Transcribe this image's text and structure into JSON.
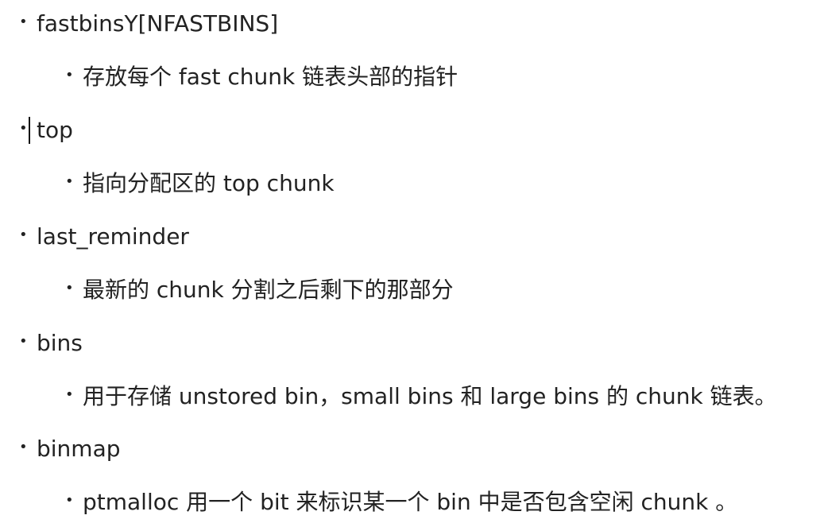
{
  "bullet_glyph": "•",
  "items": [
    {
      "term": "fastbinsY[NFASTBINS]",
      "description": "存放每个 fast chunk 链表头部的指针"
    },
    {
      "term": "top",
      "description": "指向分配区的 top chunk"
    },
    {
      "term": "last_reminder",
      "description": "最新的 chunk 分割之后剩下的那部分"
    },
    {
      "term": "bins",
      "description": "用于存储 unstored bin，small bins 和 large bins 的 chunk 链表。"
    },
    {
      "term": "binmap",
      "description": "ptmalloc 用一个 bit 来标识某一个 bin 中是否包含空闲 chunk 。"
    }
  ]
}
